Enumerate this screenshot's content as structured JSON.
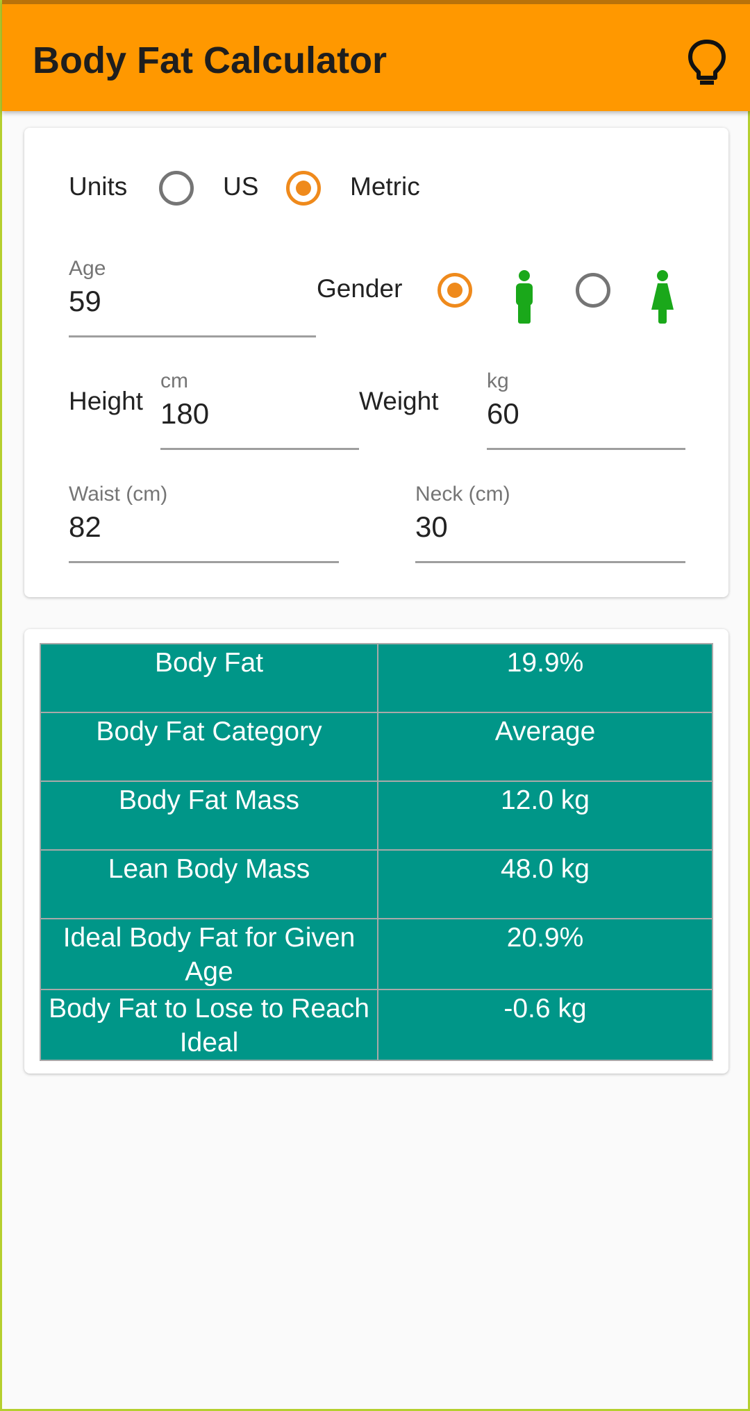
{
  "appbar": {
    "title": "Body Fat Calculator",
    "action_icon": "lightbulb-icon"
  },
  "units": {
    "label": "Units",
    "options": [
      {
        "label": "US",
        "selected": false
      },
      {
        "label": "Metric",
        "selected": true
      }
    ]
  },
  "age": {
    "label": "Age",
    "value": "59"
  },
  "gender": {
    "label": "Gender",
    "options": [
      {
        "icon": "male-icon",
        "selected": true
      },
      {
        "icon": "female-icon",
        "selected": false
      }
    ]
  },
  "height": {
    "label": "Height",
    "unit": "cm",
    "value": "180"
  },
  "weight": {
    "label": "Weight",
    "unit": "kg",
    "value": "60"
  },
  "waist": {
    "label": "Waist (cm)",
    "value": "82"
  },
  "neck": {
    "label": "Neck (cm)",
    "value": "30"
  },
  "results": [
    {
      "label": "Body Fat",
      "value": "19.9%"
    },
    {
      "label": "Body Fat Category",
      "value": "Average"
    },
    {
      "label": "Body Fat Mass",
      "value": "12.0 kg"
    },
    {
      "label": "Lean Body Mass",
      "value": "48.0 kg"
    },
    {
      "label": "Ideal Body Fat for Given Age",
      "value": "20.9%"
    },
    {
      "label": "Body Fat to Lose to Reach Ideal",
      "value": "-0.6 kg"
    }
  ],
  "colors": {
    "appbar": "#ff9800",
    "accent": "#ef8a1c",
    "table": "#009688",
    "gender_icon": "#1aa81a"
  }
}
